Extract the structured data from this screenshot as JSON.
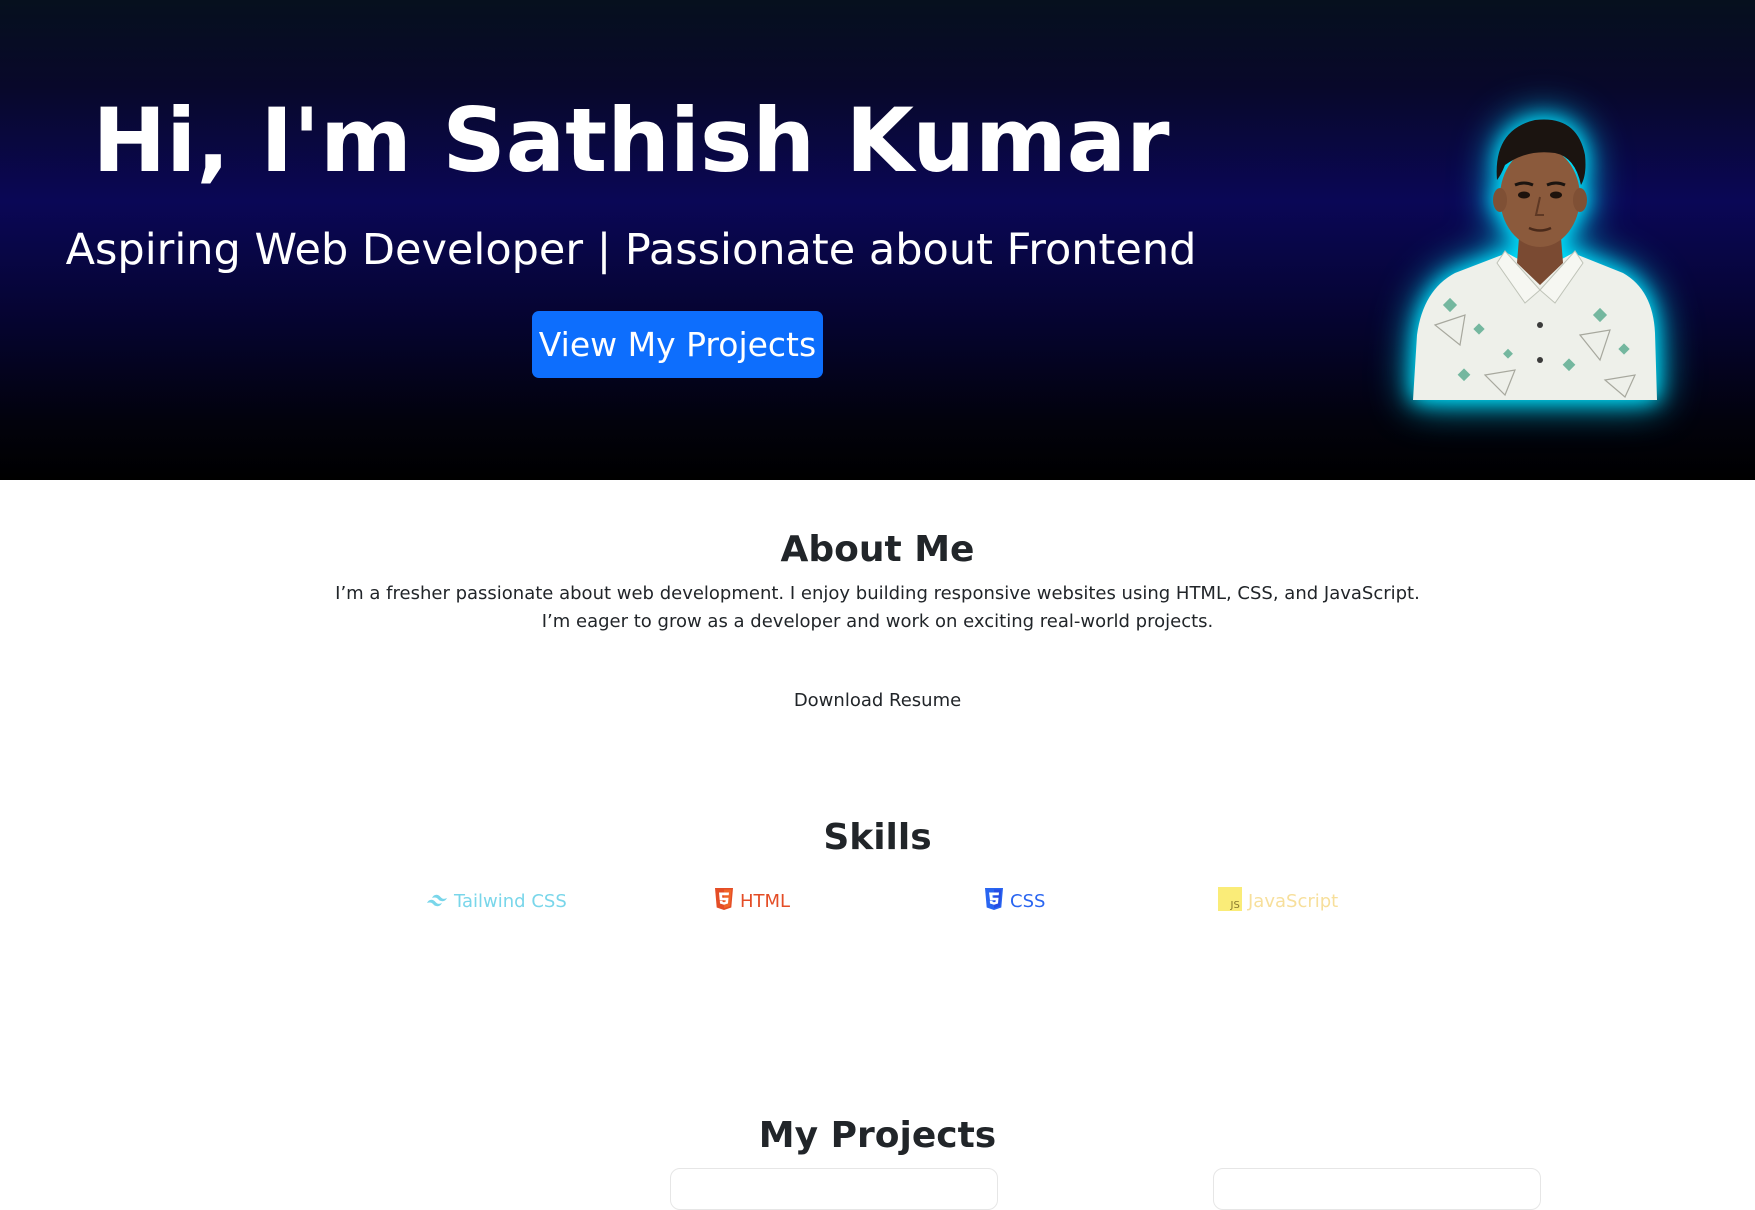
{
  "hero": {
    "title": "Hi, I'm Sathish Kumar",
    "subtitle": "Aspiring Web Developer | Passionate about Frontend",
    "button_label": "View My Projects",
    "button_color": "#0d6efd",
    "photo_glow_color": "#00e5ff"
  },
  "about": {
    "title": "About Me",
    "line1": "I’m a fresher passionate about web development. I enjoy building responsive websites using HTML, CSS, and JavaScript.",
    "line2": "I’m eager to grow as a developer and work on exciting real-world projects.",
    "resume_label": "Download Resume"
  },
  "skills": {
    "title": "Skills",
    "items": [
      {
        "label": "Tailwind CSS",
        "icon": "tailwind-icon",
        "color": "#79d6ea"
      },
      {
        "label": "HTML",
        "icon": "html5-icon",
        "color": "#e44d26"
      },
      {
        "label": "CSS",
        "icon": "css3-icon",
        "color": "#2965f1"
      },
      {
        "label": "JavaScript",
        "icon": "javascript-icon",
        "color": "#f7df9b"
      }
    ]
  },
  "projects": {
    "title": "My Projects"
  }
}
